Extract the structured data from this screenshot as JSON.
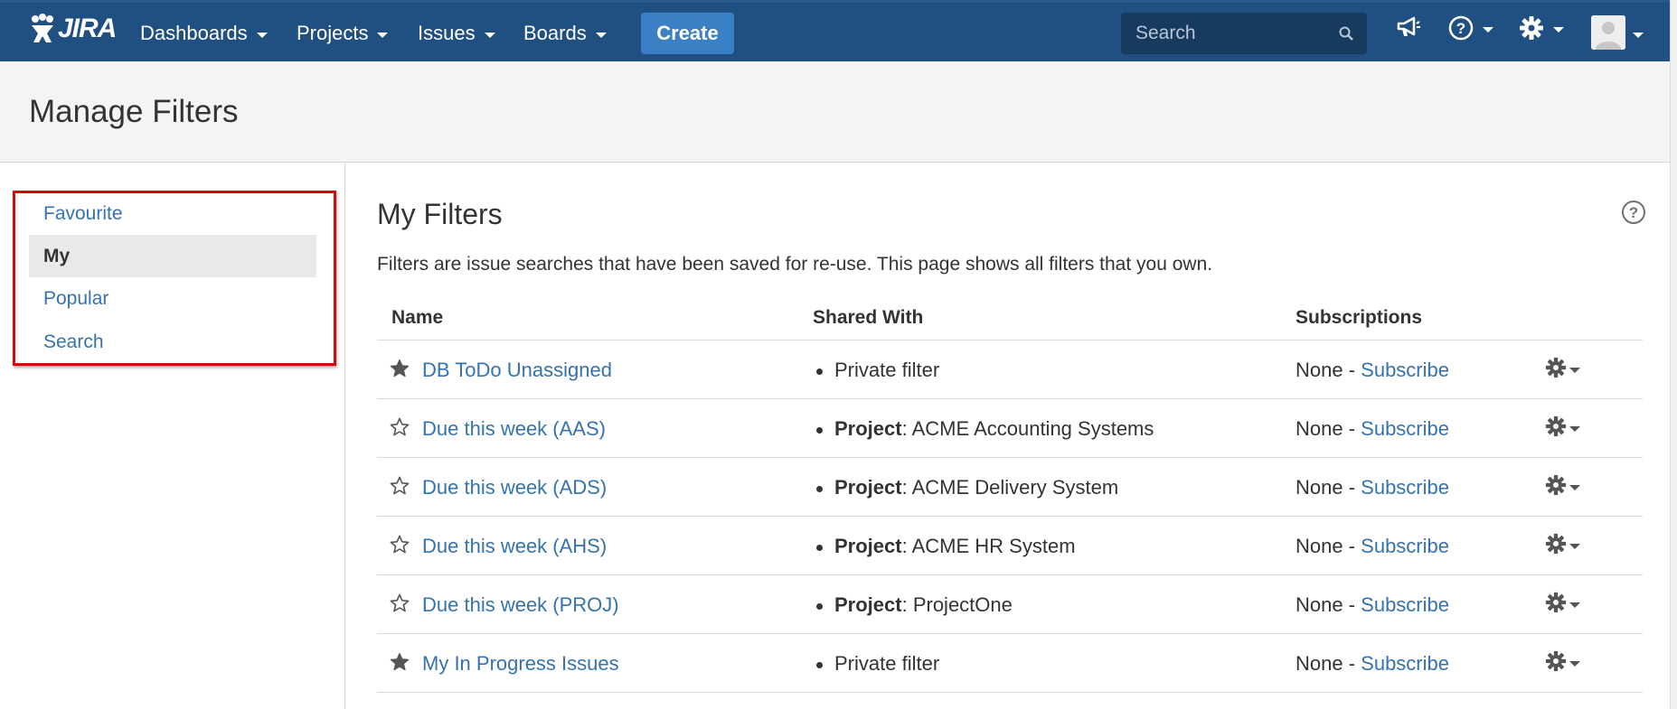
{
  "topbar": {
    "logo_text": "JIRA",
    "nav": [
      {
        "label": "Dashboards"
      },
      {
        "label": "Projects"
      },
      {
        "label": "Issues"
      },
      {
        "label": "Boards"
      }
    ],
    "create_label": "Create",
    "search_placeholder": "Search",
    "icons": [
      "search-icon",
      "megaphone-icon",
      "help-icon",
      "gear-icon",
      "avatar"
    ]
  },
  "page": {
    "title": "Manage Filters"
  },
  "sidebar": {
    "items": [
      {
        "label": "Favourite",
        "active": false
      },
      {
        "label": "My",
        "active": true
      },
      {
        "label": "Popular",
        "active": false
      },
      {
        "label": "Search",
        "active": false
      }
    ],
    "highlight_color": "#d10a0a"
  },
  "main": {
    "title": "My Filters",
    "description": "Filters are issue searches that have been saved for re-use. This page shows all filters that you own.",
    "columns": {
      "name": "Name",
      "shared_with": "Shared With",
      "subscriptions": "Subscriptions"
    },
    "rows": [
      {
        "name": "DB ToDo Unassigned",
        "favourite": true,
        "shared_label": "",
        "shared_value": "Private filter",
        "subs_none": "None - ",
        "subs_link": "Subscribe"
      },
      {
        "name": "Due this week (AAS)",
        "favourite": false,
        "shared_label": "Project",
        "shared_value": ": ACME Accounting Systems",
        "subs_none": "None - ",
        "subs_link": "Subscribe"
      },
      {
        "name": "Due this week (ADS)",
        "favourite": false,
        "shared_label": "Project",
        "shared_value": ": ACME Delivery System",
        "subs_none": "None - ",
        "subs_link": "Subscribe"
      },
      {
        "name": "Due this week (AHS)",
        "favourite": false,
        "shared_label": "Project",
        "shared_value": ": ACME HR System",
        "subs_none": "None - ",
        "subs_link": "Subscribe"
      },
      {
        "name": "Due this week (PROJ)",
        "favourite": false,
        "shared_label": "Project",
        "shared_value": ": ProjectOne",
        "subs_none": "None - ",
        "subs_link": "Subscribe"
      },
      {
        "name": "My In Progress Issues",
        "favourite": true,
        "shared_label": "",
        "shared_value": "Private filter",
        "subs_none": "None - ",
        "subs_link": "Subscribe"
      }
    ]
  },
  "colors": {
    "topbar": "#205081",
    "create_button": "#3b7fc4",
    "link": "#3572b0",
    "active_bg": "#e9e9e9"
  }
}
